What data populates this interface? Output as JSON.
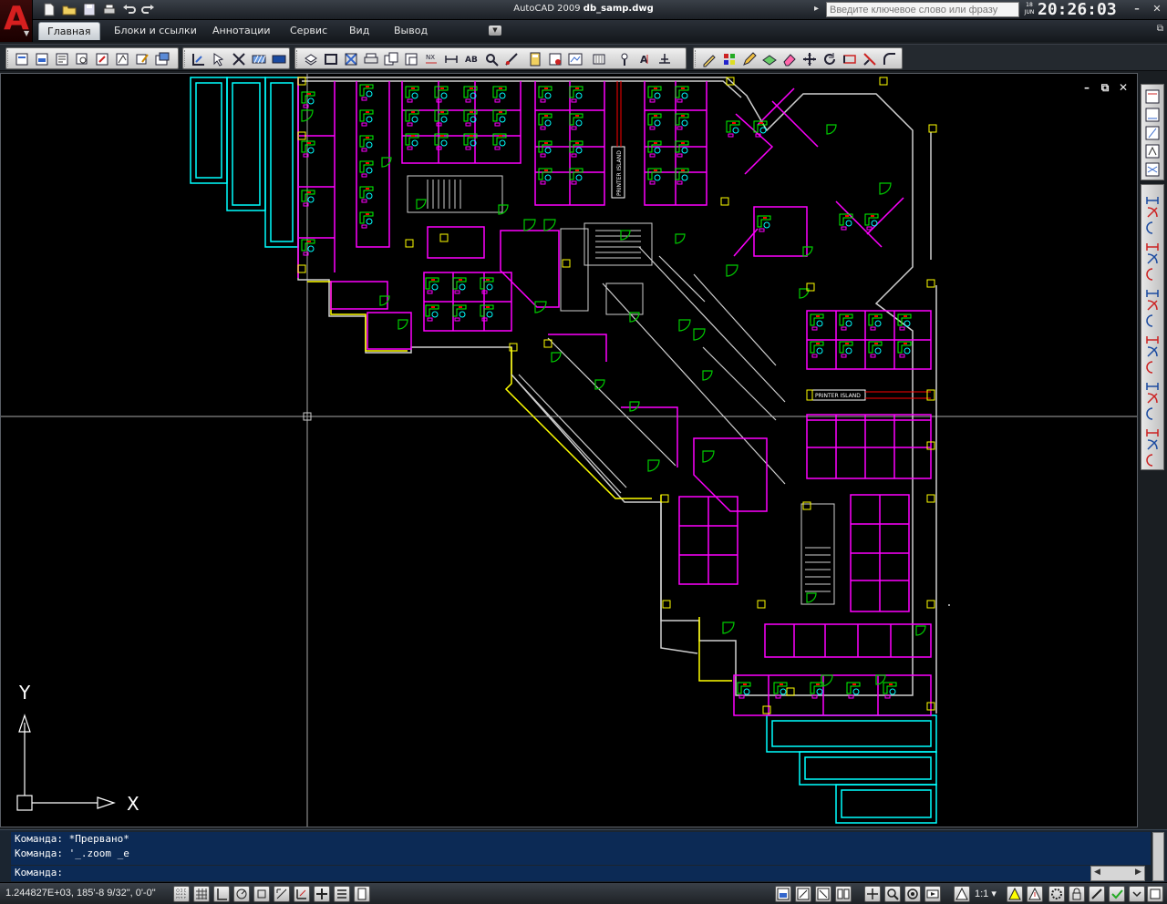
{
  "titlebar": {
    "app_name": "AutoCAD 2009",
    "file_name": "db_samp.dwg",
    "search_placeholder": "Введите ключевое слово или фразу",
    "date_day": "18",
    "date_month": "JUN",
    "clock": "20:26:03"
  },
  "menu": {
    "tabs": [
      "Главная",
      "Блоки и ссылки",
      "Аннотации",
      "Сервис",
      "Вид",
      "Вывод"
    ],
    "active_tab": "Главная"
  },
  "drawing": {
    "labels": {
      "printer_island_vertical": "PRINTER ISLAND",
      "printer_island_horizontal": "PRINTER ISLAND"
    },
    "ucs": {
      "x_label": "X",
      "y_label": "Y"
    }
  },
  "command": {
    "history": [
      "Команда: *Прервано*",
      "Команда: '_.zoom _e"
    ],
    "prompt": "Команда:",
    "input_value": ""
  },
  "status": {
    "coordinates": "1.244827E+03, 185'-8 9/32\", 0'-0\"",
    "annotation_scale": "1:1"
  },
  "colors": {
    "drawing_background": "#000000",
    "walls_magenta": "#ff00ff",
    "furniture_green": "#00ff00",
    "chairs_cyan": "#00ffff",
    "yellow": "#ffff00",
    "doors_green": "#00cc00",
    "labels_red": "#ff0000",
    "structure_white": "#ffffff",
    "command_background": "#0c2a55"
  }
}
